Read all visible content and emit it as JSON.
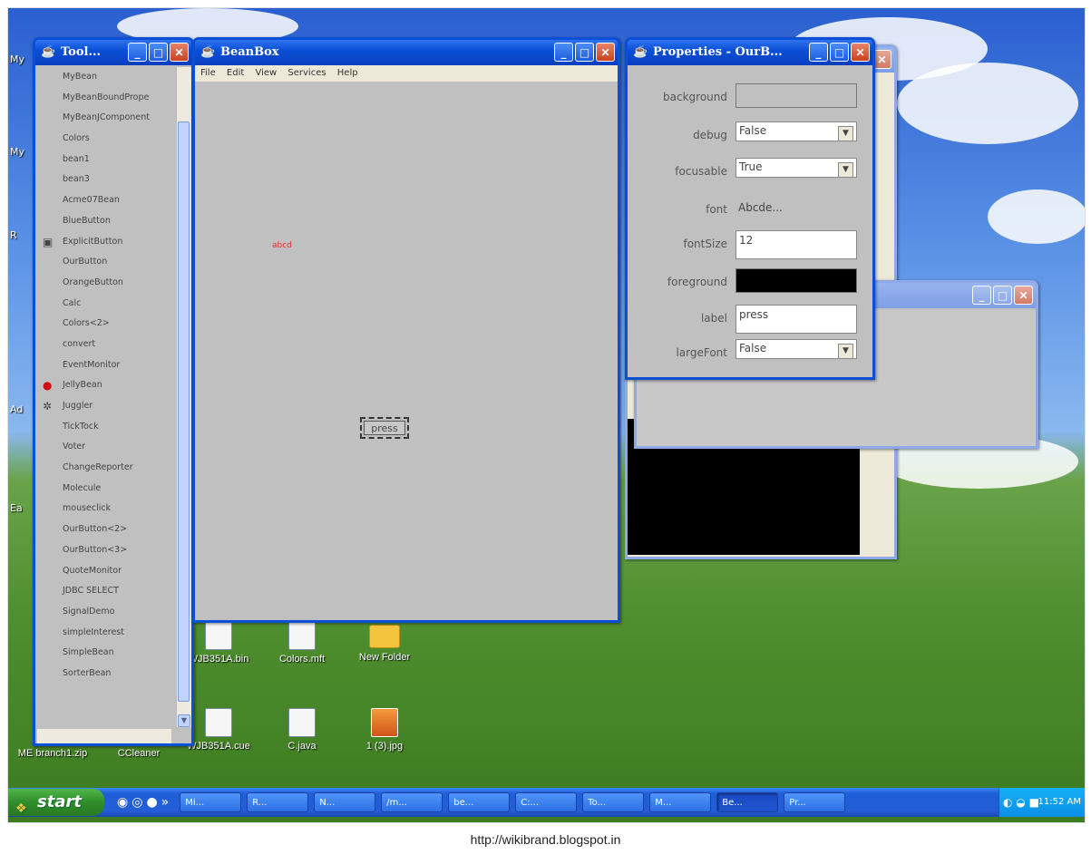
{
  "desktop": {
    "icons": [
      {
        "label": "WJB351A.bin",
        "kind": "doc"
      },
      {
        "label": "Colors.mft",
        "kind": "doc"
      },
      {
        "label": "New Folder",
        "kind": "folder"
      },
      {
        "label": "ME branch1.zip",
        "kind": "doc"
      },
      {
        "label": "CCleaner",
        "kind": "doc"
      },
      {
        "label": "WJB351A.cue",
        "kind": "doc"
      },
      {
        "label": "C.java",
        "kind": "doc"
      },
      {
        "label": "1 (3).jpg",
        "kind": "img"
      }
    ],
    "left_labels": [
      "My",
      "My",
      "R",
      "Ad",
      "Ea"
    ]
  },
  "toolbox": {
    "title": "Tool...",
    "items": [
      {
        "label": "MyBean",
        "icon": ""
      },
      {
        "label": "MyBeanBoundPrope",
        "icon": ""
      },
      {
        "label": "MyBeanJComponent",
        "icon": ""
      },
      {
        "label": "Colors",
        "icon": ""
      },
      {
        "label": "bean1",
        "icon": ""
      },
      {
        "label": "bean3",
        "icon": ""
      },
      {
        "label": "Acme07Bean",
        "icon": ""
      },
      {
        "label": "BlueButton",
        "icon": ""
      },
      {
        "label": "ExplicitButton",
        "icon": "button-icon"
      },
      {
        "label": "OurButton",
        "icon": ""
      },
      {
        "label": "OrangeButton",
        "icon": ""
      },
      {
        "label": "Calc",
        "icon": ""
      },
      {
        "label": "Colors<2>",
        "icon": ""
      },
      {
        "label": "convert",
        "icon": ""
      },
      {
        "label": "EventMonitor",
        "icon": ""
      },
      {
        "label": "JellyBean",
        "icon": "jellybean-icon"
      },
      {
        "label": "Juggler",
        "icon": "juggler-icon"
      },
      {
        "label": "TickTock",
        "icon": ""
      },
      {
        "label": "Voter",
        "icon": ""
      },
      {
        "label": "ChangeReporter",
        "icon": ""
      },
      {
        "label": "Molecule",
        "icon": ""
      },
      {
        "label": "mouseclick",
        "icon": ""
      },
      {
        "label": "OurButton<2>",
        "icon": ""
      },
      {
        "label": "OurButton<3>",
        "icon": ""
      },
      {
        "label": "QuoteMonitor",
        "icon": ""
      },
      {
        "label": "JDBC SELECT",
        "icon": ""
      },
      {
        "label": "SignalDemo",
        "icon": ""
      },
      {
        "label": "simpleInterest",
        "icon": ""
      },
      {
        "label": "SimpleBean",
        "icon": ""
      },
      {
        "label": "SorterBean",
        "icon": ""
      }
    ]
  },
  "beanbox": {
    "title": "BeanBox",
    "menu": [
      "File",
      "Edit",
      "View",
      "Services",
      "Help"
    ],
    "canvas_text": "abcd",
    "button_label": "press",
    "text_color": "#e03030"
  },
  "properties": {
    "title": "Properties - OurB...",
    "rows": [
      {
        "label": "background",
        "type": "color",
        "value": "",
        "color": "#c0c0c0"
      },
      {
        "label": "debug",
        "type": "select",
        "value": "False"
      },
      {
        "label": "focusable",
        "type": "select",
        "value": "True"
      },
      {
        "label": "font",
        "type": "text",
        "value": "Abcde..."
      },
      {
        "label": "fontSize",
        "type": "field",
        "value": "12"
      },
      {
        "label": "foreground",
        "type": "color",
        "value": "",
        "color": "#000000"
      },
      {
        "label": "label",
        "type": "field",
        "value": "press"
      },
      {
        "label": "largeFont",
        "type": "select",
        "value": "False"
      }
    ]
  },
  "taskbar": {
    "start_label": "start",
    "tasks": [
      "Mi...",
      "R...",
      "N...",
      "/m...",
      "be...",
      "C:...",
      "To...",
      "M...",
      "Be...",
      "Pr..."
    ],
    "active_task_index": 8,
    "clock": "11:52 AM",
    "overflow": "»"
  },
  "credit": "http://wikibrand.blogspot.in"
}
